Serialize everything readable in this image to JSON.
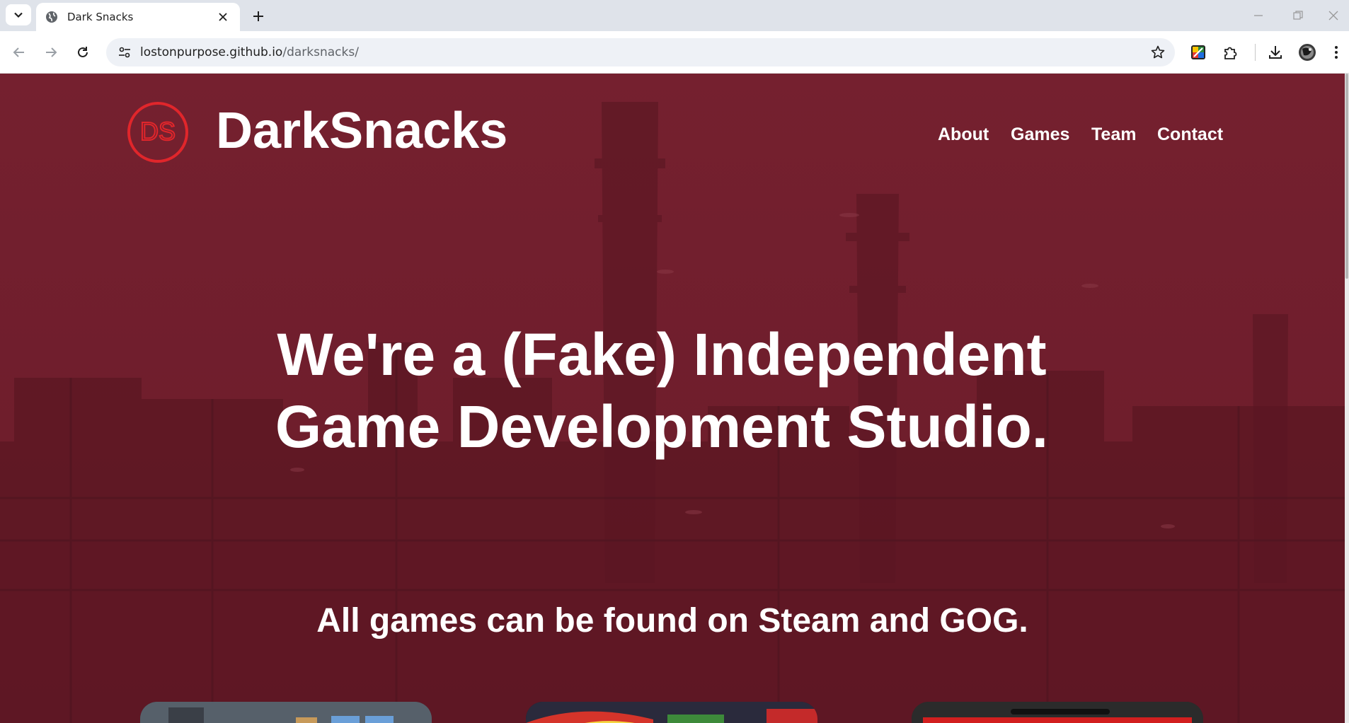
{
  "browser": {
    "tab_title": "Dark Snacks",
    "url_host": "lostonpurpose.github.io",
    "url_path": "/darksnacks/"
  },
  "site": {
    "logo_text": "DS",
    "brand": "DarkSnacks",
    "nav": [
      {
        "label": "About"
      },
      {
        "label": "Games"
      },
      {
        "label": "Team"
      },
      {
        "label": "Contact"
      }
    ],
    "hero_line1": "We're a (Fake) Independent",
    "hero_line2": "Game Development Studio.",
    "subheading": "All games can be found on Steam and GOG."
  },
  "colors": {
    "accent": "#e0262b",
    "overlay": "#6f1e2c",
    "text": "#ffffff"
  },
  "icons": [
    "tab-search-icon",
    "globe-icon",
    "close-icon",
    "plus-icon",
    "minimize-icon",
    "restore-icon",
    "window-close-icon",
    "back-icon",
    "forward-icon",
    "reload-icon",
    "site-info-icon",
    "star-icon",
    "color-extension-icon",
    "puzzle-icon",
    "download-icon",
    "avatar",
    "menu-icon"
  ]
}
